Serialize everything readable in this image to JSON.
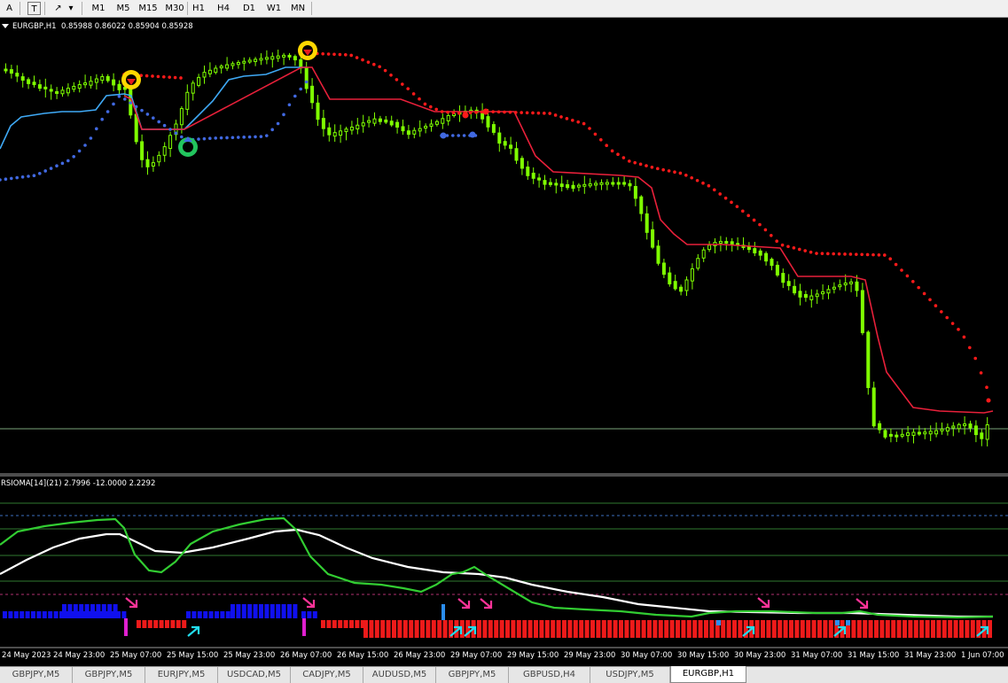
{
  "toolbar": {
    "icons": [
      "text-tool-icon",
      "text-label-icon",
      "arrows-tool-icon"
    ],
    "icon_glyphs": [
      "A",
      "T",
      "↗"
    ],
    "timeframes": [
      "M1",
      "M5",
      "M15",
      "M30",
      "H1",
      "H4",
      "D1",
      "W1",
      "MN"
    ]
  },
  "main_chart": {
    "info": "EURGBP,H1  0.85988 0.86022 0.85904 0.85928"
  },
  "sub_chart": {
    "info": "RSIOMA[14](21) 2.7996 -12.0000 2.2292"
  },
  "x_axis": {
    "labels": [
      "24 May 2023",
      "24 May 23:00",
      "25 May 07:00",
      "25 May 15:00",
      "25 May 23:00",
      "26 May 07:00",
      "26 May 15:00",
      "26 May 23:00",
      "29 May 07:00",
      "29 May 15:00",
      "29 May 23:00",
      "30 May 07:00",
      "30 May 15:00",
      "30 May 23:00",
      "31 May 07:00",
      "31 May 15:00",
      "31 May 23:00",
      "1 Jun 07:00"
    ]
  },
  "tabs": [
    "GBPJPY,M5",
    "GBPJPY,M5",
    "EURJPY,M5",
    "USDCAD,M5",
    "CADJPY,M5",
    "AUDUSD,M5",
    "GBPJPY,M5",
    "GBPUSD,H4",
    "USDJPY,M5",
    "EURGBP,H1"
  ],
  "active_tab": "EURGBP,H1",
  "colors": {
    "background": "#000000",
    "candle": "#7fff00",
    "stop_line_up": "#3fa9f5",
    "stop_line_down": "#e8203a",
    "dots_up": "#4169e1",
    "dots_down": "#ff1a1a",
    "rsioma_line": "#32cd32",
    "signal_line": "#ffffff",
    "hist_up": "#1010ee",
    "hist_down": "#ee1a1a",
    "arrow_down": "#ff3399",
    "arrow_up": "#22ddee"
  }
}
